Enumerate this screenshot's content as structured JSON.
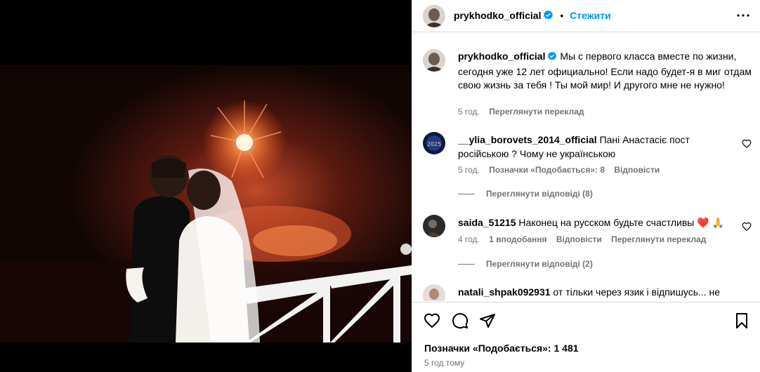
{
  "header": {
    "username": "prykhodko_official",
    "separator": "•",
    "follow_label": "Стежити"
  },
  "caption": {
    "username": "prykhodko_official",
    "text": "Мы с первого класса вместе по жизни, сегодня уже 12 лет официально! Если надо будет-я в миг отдам свою жизнь за тебя ! Ты мой мир! И другого мне не нужно!",
    "time": "5 год.",
    "translate": "Переглянути переклад"
  },
  "comments": [
    {
      "username": "__ylia_borovets_2014_official",
      "text": "Пані Анастасіє пост російською ? Чому не українською",
      "time": "5 год.",
      "likes": "Позначки «Подобається»: 8",
      "reply": "Відповісти",
      "view_replies": "Переглянути відповіді (8)"
    },
    {
      "username": "saida_51215",
      "text": "Наконец на русском будьте счастливы ❤️ 🙏",
      "time": "4 год.",
      "likes": "1 вподобання",
      "reply": "Відповісти",
      "translate": "Переглянути переклад",
      "view_replies": "Переглянути відповіді (2)"
    },
    {
      "username": "natali_shpak092931",
      "text": "от тільки через язик і відпишусь... не"
    }
  ],
  "actions": {
    "like_icon": "heart-icon",
    "comment_icon": "comment-icon",
    "share_icon": "share-icon",
    "save_icon": "bookmark-icon"
  },
  "likes_text": "Позначки «Подобається»: 1 481",
  "timestamp": "5 год тому",
  "colors": {
    "accent": "#0095f6",
    "verified": "#0095f6",
    "muted": "#737373",
    "heart": "#ed1c24"
  }
}
